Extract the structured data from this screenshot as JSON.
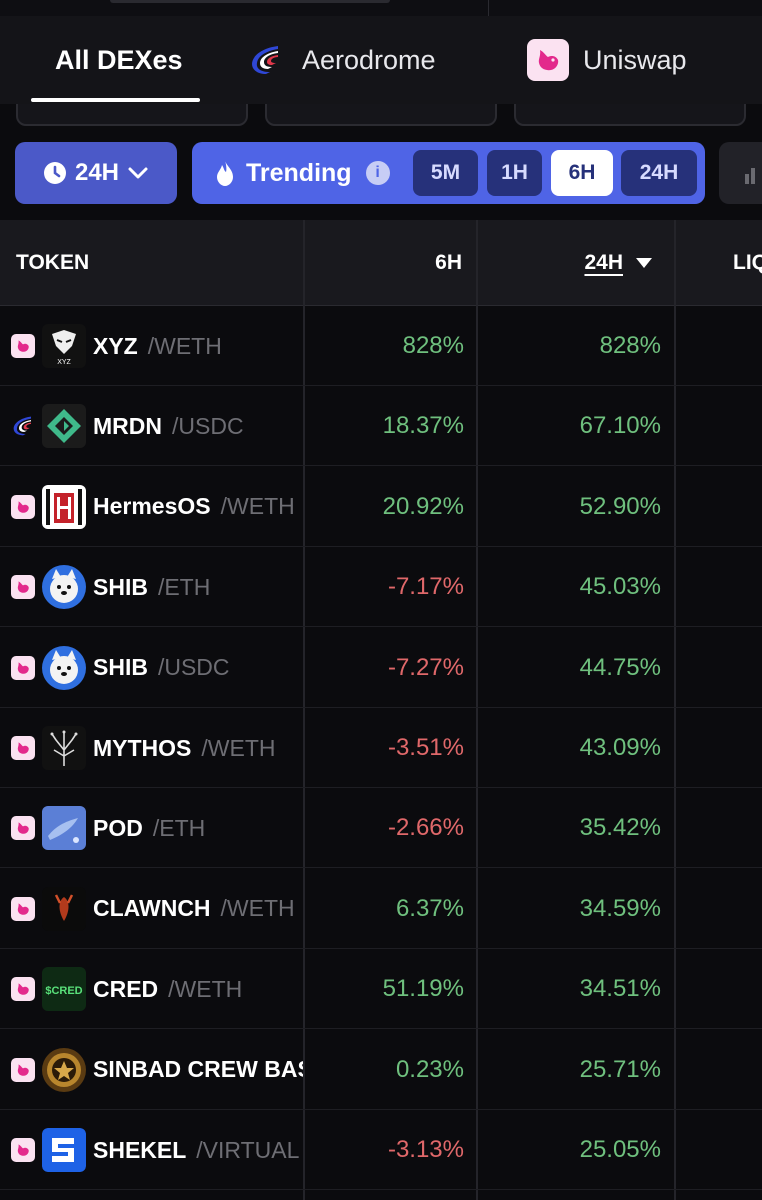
{
  "tabs": [
    {
      "label": "All DEXes",
      "active": true
    },
    {
      "label": "Aerodrome",
      "icon": "aerodrome-logo-icon"
    },
    {
      "label": "Uniswap",
      "icon": "uniswap-logo-icon"
    }
  ],
  "filters": {
    "timeframe_label": "24H",
    "trending_label": "Trending",
    "trend_options": [
      "5M",
      "1H",
      "6H",
      "24H"
    ],
    "active_option": "6H"
  },
  "table": {
    "headers": {
      "token": "TOKEN",
      "h6": "6H",
      "h24": "24H",
      "liq": "LIQ"
    },
    "rows": [
      {
        "dex": "uniswap",
        "name": "XYZ",
        "quote": "/WETH",
        "h6": "828%",
        "h24": "828%",
        "h6_sign": "pos"
      },
      {
        "dex": "aerodrome",
        "name": "MRDN",
        "quote": "/USDC",
        "h6": "18.37%",
        "h24": "67.10%",
        "h6_sign": "pos"
      },
      {
        "dex": "uniswap",
        "name": "HermesOS",
        "quote": "/WETH",
        "h6": "20.92%",
        "h24": "52.90%",
        "h6_sign": "pos"
      },
      {
        "dex": "uniswap",
        "name": "SHIB",
        "quote": "/ETH",
        "h6": "-7.17%",
        "h24": "45.03%",
        "h6_sign": "neg"
      },
      {
        "dex": "uniswap",
        "name": "SHIB",
        "quote": "/USDC",
        "h6": "-7.27%",
        "h24": "44.75%",
        "h6_sign": "neg"
      },
      {
        "dex": "uniswap",
        "name": "MYTHOS",
        "quote": "/WETH",
        "h6": "-3.51%",
        "h24": "43.09%",
        "h6_sign": "neg"
      },
      {
        "dex": "uniswap",
        "name": "POD",
        "quote": "/ETH",
        "h6": "-2.66%",
        "h24": "35.42%",
        "h6_sign": "neg"
      },
      {
        "dex": "uniswap",
        "name": "CLAWNCH",
        "quote": "/WETH",
        "h6": "6.37%",
        "h24": "34.59%",
        "h6_sign": "pos"
      },
      {
        "dex": "uniswap",
        "name": "CRED",
        "quote": "/WETH",
        "h6": "51.19%",
        "h24": "34.51%",
        "h6_sign": "pos"
      },
      {
        "dex": "uniswap",
        "name": "SINBAD CREW BASE",
        "quote": "",
        "h6": "0.23%",
        "h24": "25.71%",
        "h6_sign": "pos"
      },
      {
        "dex": "uniswap",
        "name": "SHEKEL",
        "quote": "/VIRTUAL",
        "h6": "-3.13%",
        "h24": "25.05%",
        "h6_sign": "neg"
      }
    ]
  },
  "colors": {
    "positive": "#6fc07e",
    "negative": "#e0686a",
    "accent": "#4f64e6"
  }
}
